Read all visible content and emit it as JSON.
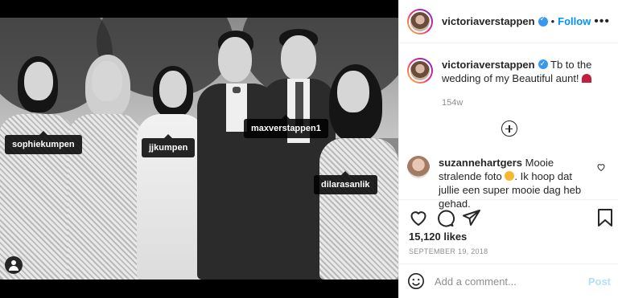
{
  "photo": {
    "tags": [
      "sophiekumpen",
      "jjkumpen",
      "maxverstappen1",
      "dilarasanlik"
    ]
  },
  "header": {
    "username": "victoriaverstappen",
    "separator": "•",
    "follow_label": "Follow",
    "more_label": "•••"
  },
  "caption": {
    "username": "victoriaverstappen",
    "text": "Tb to the wedding of my Beautiful aunt!",
    "time": "154w"
  },
  "comments": [
    {
      "username": "suzannehartgers",
      "text_before": "Mooie stralende foto",
      "text_after": ". Ik hoop dat jullie een super mooie dag heb gehad."
    }
  ],
  "post": {
    "likes": "15,120 likes",
    "date": "SEPTEMBER 19, 2018"
  },
  "composer": {
    "placeholder": "Add a comment...",
    "post_label": "Post"
  },
  "colors": {
    "accent": "#0095f6",
    "post_disabled": "#b2dffc",
    "verified": "#3897f0",
    "muted": "#8e8e8e"
  },
  "icons": [
    "tagged-user-icon",
    "verified-badge-icon",
    "more-options-icon",
    "load-more-comments-icon",
    "comment-like-heart-icon",
    "like-heart-icon",
    "comment-bubble-icon",
    "share-plane-icon",
    "save-bookmark-icon",
    "emoji-smiley-icon"
  ]
}
